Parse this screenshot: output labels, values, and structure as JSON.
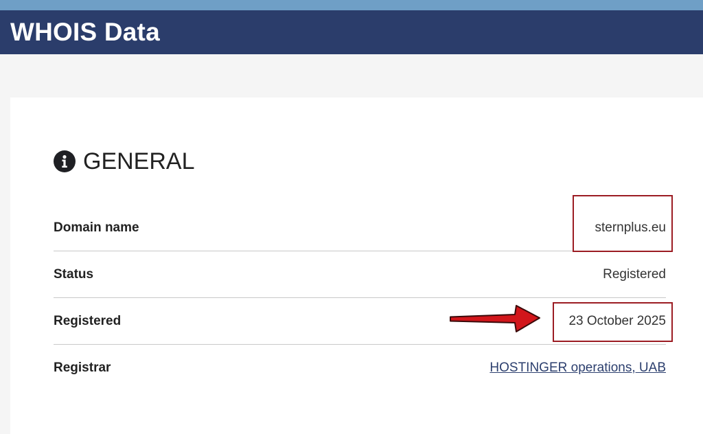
{
  "header": {
    "title": "WHOIS Data"
  },
  "section": {
    "title": "GENERAL",
    "icon": "info-circle-icon"
  },
  "rows": [
    {
      "label": "Domain name",
      "value": "sternplus.eu"
    },
    {
      "label": "Status",
      "value": "Registered"
    },
    {
      "label": "Registered",
      "value": "23 October 2025"
    },
    {
      "label": "Registrar",
      "value": "HOSTINGER operations, UAB"
    }
  ],
  "colors": {
    "header_bg": "#2b3d6b",
    "top_strip": "#6f9fc6",
    "annotation": "#9b1b22",
    "arrow": "#d2161b",
    "link": "#2c3f6e"
  }
}
